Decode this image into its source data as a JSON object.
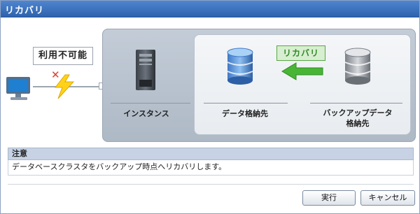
{
  "window": {
    "title": "リカバリ"
  },
  "diagram": {
    "unavailable_label": "利用不可能",
    "instance_label": "インスタンス",
    "data_destination_label": "データ格納先",
    "backup_destination_label_line1": "バックアップデータ",
    "backup_destination_label_line2": "格納先",
    "recovery_badge": "リカバリ"
  },
  "note": {
    "header": "注意",
    "text": "データベースクラスタをバックアップ時点へリカバリします。"
  },
  "buttons": {
    "run_label": "実行",
    "cancel_label": "キャンセル"
  },
  "colors": {
    "title_bar": "#3a6fbd",
    "recovery_green": "#2f8a26",
    "error_red": "#e23b2b"
  }
}
